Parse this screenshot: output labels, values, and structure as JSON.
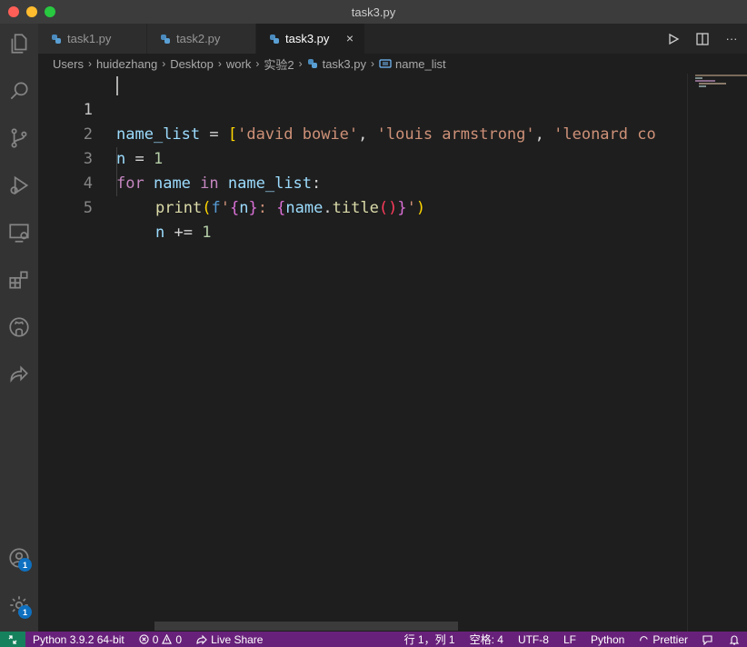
{
  "window": {
    "title": "task3.py"
  },
  "tabs": [
    {
      "label": "task1.py"
    },
    {
      "label": "task2.py"
    },
    {
      "label": "task3.py",
      "close": "×"
    }
  ],
  "tab_actions": {
    "more": "···"
  },
  "breadcrumb": [
    "Users",
    "huidezhang",
    "Desktop",
    "work",
    "实验2",
    "task3.py",
    "name_list"
  ],
  "breadcrumb_separator": "›",
  "editor": {
    "line_numbers": [
      "1",
      "2",
      "3",
      "4",
      "5"
    ],
    "line1": {
      "var": "name_list",
      "eq": " = ",
      "br": "[",
      "s1": "'david bowie'",
      "c1": ", ",
      "s2": "'louis armstrong'",
      "c2": ", ",
      "s3": "'leonard co"
    },
    "line2": {
      "var": "n",
      "eq": " = ",
      "num": "1"
    },
    "line3": {
      "kw1": "for",
      "sp1": " ",
      "var1": "name",
      "sp2": " ",
      "kw2": "in",
      "sp3": " ",
      "var2": "name_list",
      "colon": ":"
    },
    "line4": {
      "fn": "print",
      "p1": "(",
      "f": "f",
      "q1": "'",
      "b1": "{",
      "v1": "n",
      "b2": "}",
      "txt": ": ",
      "b3": "{",
      "v2": "name",
      "dot": ".",
      "fn2": "title",
      "p2": "(",
      "p3": ")",
      "b4": "}",
      "q2": "'",
      "p4": ")"
    },
    "line5": {
      "var": "n",
      "op": " += ",
      "num": "1"
    }
  },
  "activity_badges": {
    "accounts": "1",
    "settings": "1"
  },
  "status": {
    "python": "Python 3.9.2 64-bit",
    "errors": "0",
    "warnings": "0",
    "liveshare": "Live Share",
    "position": "行 1，列 1",
    "spaces": "空格: 4",
    "encoding": "UTF-8",
    "eol": "LF",
    "language": "Python",
    "prettier": "Prettier"
  },
  "colors": {
    "statusbar": "#68217a",
    "remote": "#16825d",
    "keyword": "#c586c0",
    "string": "#ce9178",
    "number": "#b5cea8",
    "function": "#dcdcaa",
    "bracket_gold": "#ffd700",
    "bracket_orchid": "#da70d6",
    "bracket_blue": "#179fff"
  }
}
